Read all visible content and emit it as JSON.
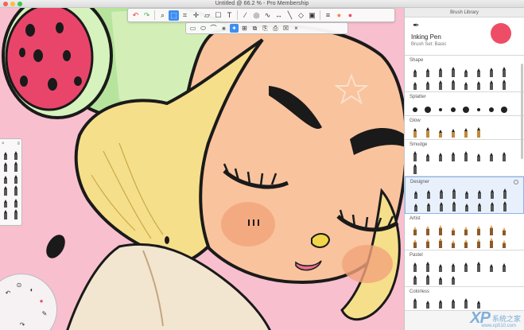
{
  "window": {
    "title": "Untitled @ 66.2 % - Pro Membership"
  },
  "toolbar": {
    "tools": [
      {
        "icon": "undo-icon",
        "glyph": "↶",
        "active": false
      },
      {
        "icon": "redo-icon",
        "glyph": "↷",
        "active": false
      },
      {
        "icon": "zoom-icon",
        "glyph": "⌕",
        "active": false
      },
      {
        "icon": "select-icon",
        "glyph": "⬚",
        "active": true
      },
      {
        "icon": "crop-icon",
        "glyph": "⌗",
        "active": false
      },
      {
        "icon": "transform-icon",
        "glyph": "✛",
        "active": false
      },
      {
        "icon": "distort-icon",
        "glyph": "▱",
        "active": false
      },
      {
        "icon": "shape-icon",
        "glyph": "☐",
        "active": false
      },
      {
        "icon": "text-icon",
        "glyph": "T",
        "active": false
      },
      {
        "icon": "ruler-icon",
        "glyph": "∕",
        "active": false
      },
      {
        "icon": "ellipse-guide-icon",
        "glyph": "◎",
        "active": false
      },
      {
        "icon": "french-curve-icon",
        "glyph": "∿",
        "active": false
      },
      {
        "icon": "symmetry-icon",
        "glyph": "↔",
        "active": false
      },
      {
        "icon": "stroke-icon",
        "glyph": "╲",
        "active": false
      },
      {
        "icon": "perspective-icon",
        "glyph": "◇",
        "active": false
      },
      {
        "icon": "fill-icon",
        "glyph": "▣",
        "active": false
      },
      {
        "icon": "layers-icon",
        "glyph": "≡",
        "active": false
      },
      {
        "icon": "color-wheel-icon",
        "glyph": "●",
        "active": false
      },
      {
        "icon": "color-swatch-icon",
        "glyph": "●",
        "active": false
      }
    ],
    "subtools": [
      {
        "icon": "rect-select-icon",
        "glyph": "▭",
        "active": false
      },
      {
        "icon": "ellipse-select-icon",
        "glyph": "⬭",
        "active": false
      },
      {
        "icon": "freeform-select-icon",
        "glyph": "⌒",
        "active": false
      },
      {
        "icon": "polyline-select-icon",
        "glyph": "⨳",
        "active": false
      },
      {
        "icon": "magic-wand-icon",
        "glyph": "✦",
        "active": true
      },
      {
        "icon": "add-select-icon",
        "glyph": "⊞",
        "active": false
      },
      {
        "icon": "invert-select-icon",
        "glyph": "⧉",
        "active": false
      },
      {
        "icon": "copy-icon",
        "glyph": "⎘",
        "active": false
      },
      {
        "icon": "paste-icon",
        "glyph": "⎙",
        "active": false
      },
      {
        "icon": "clear-select-icon",
        "glyph": "☒",
        "active": false
      },
      {
        "icon": "close-subtool-icon",
        "glyph": "×",
        "active": false
      }
    ]
  },
  "brush_library": {
    "title": "Brush Library",
    "current_brush": {
      "name": "Inking Pen",
      "set": "Brush Set: Basic",
      "color": "#ee4d67"
    },
    "sections": [
      {
        "name": "Shape",
        "rows": 2,
        "selected": false,
        "count": 16
      },
      {
        "name": "Splatter",
        "rows": 1,
        "selected": false,
        "count": 8
      },
      {
        "name": "Glow",
        "rows": 1,
        "selected": false,
        "count": 6
      },
      {
        "name": "Smudge",
        "rows": 2,
        "selected": false,
        "count": 9
      },
      {
        "name": "Designer",
        "rows": 2,
        "selected": true,
        "count": 16
      },
      {
        "name": "Artist",
        "rows": 2,
        "selected": false,
        "count": 16
      },
      {
        "name": "Pastel",
        "rows": 2,
        "selected": false,
        "count": 12
      },
      {
        "name": "Colorless",
        "rows": 1,
        "selected": false,
        "count": 6
      }
    ]
  },
  "left_palette": {
    "brushes": 12
  },
  "watermark": {
    "logo": "XP",
    "text": "系统之家",
    "url": "www.xp510.com"
  },
  "colors": {
    "canvas_pink": "#f8bfcf",
    "skin": "#f9c39d",
    "hair": "#f6df8a",
    "melon_red": "#e9456b",
    "melon_green": "#b6e49c",
    "accent": "#3d8ef0"
  }
}
